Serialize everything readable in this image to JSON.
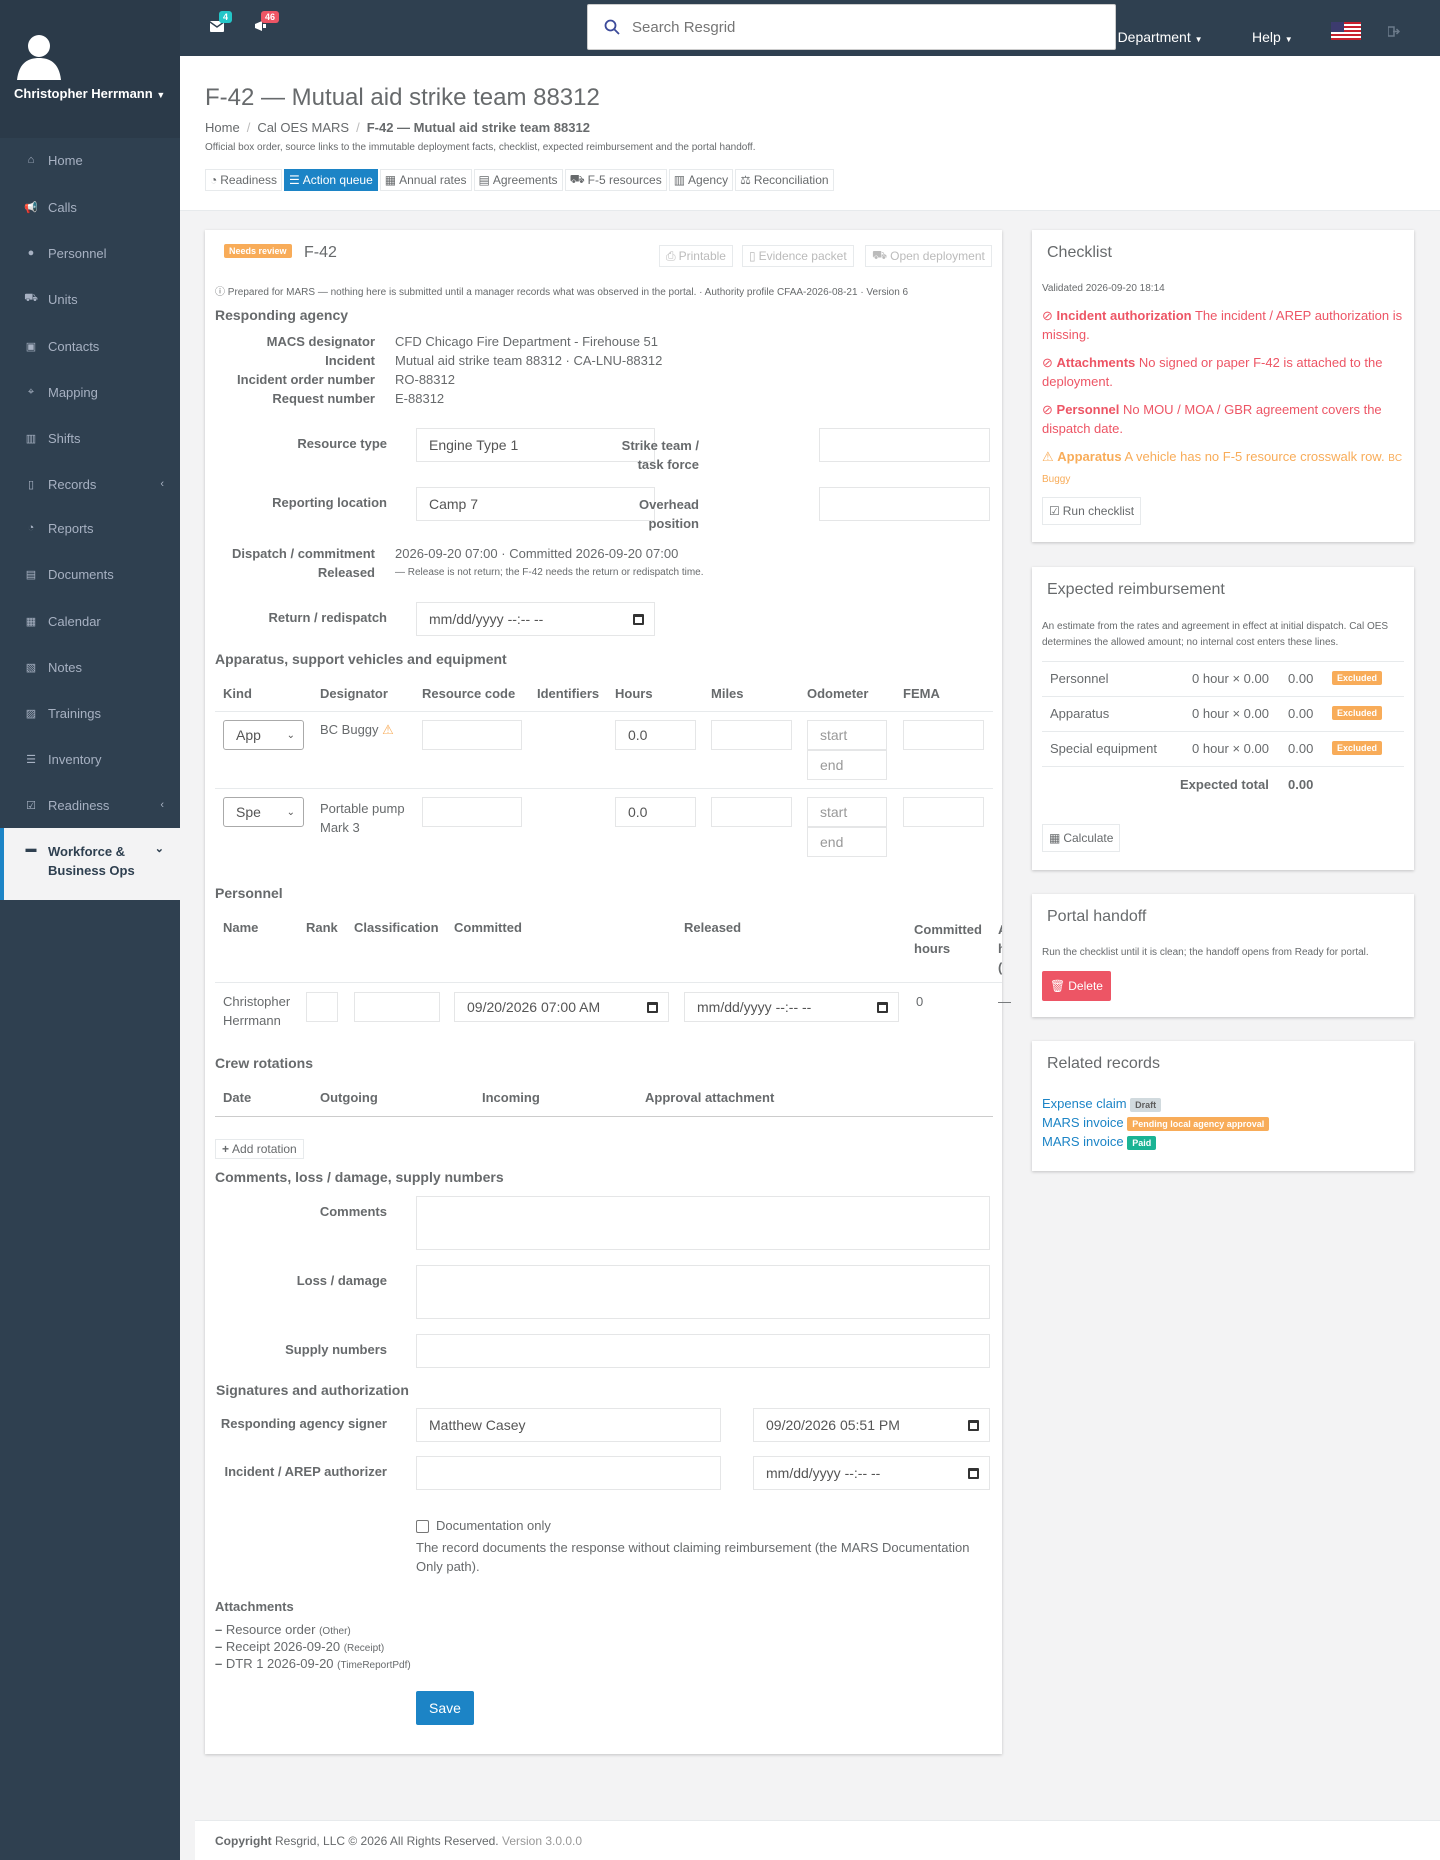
{
  "user": {
    "name": "Christopher Herrmann"
  },
  "nav": [
    {
      "label": "Home",
      "icon": "home-icon"
    },
    {
      "label": "Calls",
      "icon": "bullhorn-icon"
    },
    {
      "label": "Personnel",
      "icon": "user-icon"
    },
    {
      "label": "Units",
      "icon": "truck-icon"
    },
    {
      "label": "Contacts",
      "icon": "address-book-icon"
    },
    {
      "label": "Mapping",
      "icon": "map-marker-icon"
    },
    {
      "label": "Shifts",
      "icon": "building-icon"
    },
    {
      "label": "Records",
      "icon": "file-icon"
    },
    {
      "label": "Reports",
      "icon": "chart-icon"
    },
    {
      "label": "Documents",
      "icon": "document-icon"
    },
    {
      "label": "Calendar",
      "icon": "calendar-icon"
    },
    {
      "label": "Notes",
      "icon": "notes-icon"
    },
    {
      "label": "Trainings",
      "icon": "book-icon"
    },
    {
      "label": "Inventory",
      "icon": "list-icon"
    },
    {
      "label": "Readiness",
      "icon": "check-square-icon"
    },
    {
      "label": "Workforce & Business Ops",
      "icon": "briefcase-icon"
    }
  ],
  "topbar": {
    "mail_count": "4",
    "alerts_count": "46",
    "search_placeholder": "Search Resgrid",
    "department": "Test Department",
    "help": "Help"
  },
  "page": {
    "title": "F-42 — Mutual aid strike team 88312",
    "breadcrumb": [
      "Home",
      "Cal OES MARS",
      "F-42 — Mutual aid strike team 88312"
    ],
    "subtitle": "Official box order, source links to the immutable deployment facts, checklist, expected reimbursement and the portal handoff.",
    "tabs": [
      "Readiness",
      "Action queue",
      "Annual rates",
      "Agreements",
      "F-5 resources",
      "Agency",
      "Reconciliation"
    ]
  },
  "form": {
    "status_badge": "Needs review",
    "heading": "F-42",
    "buttons": {
      "printable": "Printable",
      "evidence": "Evidence packet",
      "open": "Open deployment"
    },
    "notice": "Prepared for MARS — nothing here is submitted until a manager records what was observed in the portal. · Authority profile CFAA-2026-08-21 · Version 6",
    "responding_agency": {
      "heading": "Responding agency",
      "rows": [
        {
          "label": "MACS designator",
          "value": "CFD Chicago Fire Department - Firehouse 51"
        },
        {
          "label": "Incident",
          "value": "Mutual aid strike team 88312 · CA-LNU-88312"
        },
        {
          "label": "Incident order number",
          "value": "RO-88312"
        },
        {
          "label": "Request number",
          "value": "E-88312"
        }
      ]
    },
    "resource_type_label": "Resource type",
    "resource_type_value": "Engine Type 1",
    "strike_team_label": "Strike team / task force",
    "reporting_location_label": "Reporting location",
    "reporting_location_value": "Camp 7",
    "overhead_label": "Overhead position",
    "dispatch_label": "Dispatch / commitment",
    "dispatch_value": "2026-09-20 07:00 · Committed 2026-09-20 07:00",
    "released_label": "Released",
    "released_note": "— Release is not return; the F-42 needs the return or redispatch time.",
    "return_label": "Return / redispatch",
    "datetime_placeholder": "mm/dd/yyyy --:-- --",
    "apparatus": {
      "heading": "Apparatus, support vehicles and equipment",
      "columns": [
        "Kind",
        "Designator",
        "Resource code",
        "Identifiers",
        "Hours",
        "Miles",
        "Odometer",
        "FEMA"
      ],
      "rows": [
        {
          "kind": "App",
          "designator": "BC Buggy",
          "hours": "0.0",
          "start": "start",
          "end": "end"
        },
        {
          "kind": "Spe",
          "designator": "Portable pump Mark 3",
          "hours": "0.0",
          "start": "start",
          "end": "end"
        }
      ]
    },
    "personnel": {
      "heading": "Personnel",
      "columns": [
        "Name",
        "Rank",
        "Classification",
        "Committed",
        "Released",
        "Committed hours",
        "Actual hours (DTRs"
      ],
      "row": {
        "name": "Christopher Herrmann",
        "committed": "09/20/2026 07:00 AM",
        "released": "mm/dd/yyyy --:-- --",
        "committed_hours": "0",
        "actual": "—"
      }
    },
    "crew": {
      "heading": "Crew rotations",
      "columns": [
        "Date",
        "Outgoing",
        "Incoming",
        "Approval attachment"
      ],
      "add_button": "Add rotation"
    },
    "comments": {
      "heading": "Comments, loss / damage, supply numbers",
      "comments_label": "Comments",
      "loss_label": "Loss / damage",
      "supply_label": "Supply numbers"
    },
    "signatures": {
      "heading": "Signatures and authorization",
      "signer_label": "Responding agency signer",
      "signer_value": "Matthew Casey",
      "signer_date": "09/20/2026 05:51 PM",
      "arep_label": "Incident / AREP authorizer",
      "arep_date": "mm/dd/yyyy --:-- --",
      "doc_only_label": "Documentation only",
      "doc_only_note": "The record documents the response without claiming reimbursement (the MARS Documentation Only path)."
    },
    "attachments": {
      "heading": "Attachments",
      "items": [
        {
          "name": "Resource order",
          "type": "(Other)"
        },
        {
          "name": "Receipt 2026-09-20",
          "type": "(Receipt)"
        },
        {
          "name": "DTR 1 2026-09-20",
          "type": "(TimeReportPdf)"
        }
      ]
    },
    "save": "Save"
  },
  "checklist": {
    "title": "Checklist",
    "validated": "Validated 2026-09-20 18:14",
    "items": [
      {
        "title": "Incident authorization",
        "text": "The incident / AREP authorization is missing.",
        "level": "error"
      },
      {
        "title": "Attachments",
        "text": "No signed or paper F-42 is attached to the deployment.",
        "level": "error"
      },
      {
        "title": "Personnel",
        "text": "No MOU / MOA / GBR agreement covers the dispatch date.",
        "level": "error"
      },
      {
        "title": "Apparatus",
        "text": "A vehicle has no F-5 resource crosswalk row.",
        "extra": "BC Buggy",
        "level": "warning"
      }
    ],
    "button": "Run checklist"
  },
  "reimbursement": {
    "title": "Expected reimbursement",
    "note": "An estimate from the rates and agreement in effect at initial dispatch. Cal OES determines the allowed amount; no internal cost enters these lines.",
    "rows": [
      {
        "label": "Personnel",
        "calc": "0 hour × 0.00",
        "amount": "0.00",
        "badge": "Excluded"
      },
      {
        "label": "Apparatus",
        "calc": "0 hour × 0.00",
        "amount": "0.00",
        "badge": "Excluded"
      },
      {
        "label": "Special equipment",
        "calc": "0 hour × 0.00",
        "amount": "0.00",
        "badge": "Excluded"
      }
    ],
    "total_label": "Expected total",
    "total": "0.00",
    "button": "Calculate"
  },
  "portal": {
    "title": "Portal handoff",
    "note": "Run the checklist until it is clean; the handoff opens from Ready for portal.",
    "delete": "Delete"
  },
  "related": {
    "title": "Related records",
    "items": [
      {
        "label": "Expense claim",
        "badge": "Draft",
        "color": "#d1dade"
      },
      {
        "label": "MARS invoice",
        "badge": "Pending local agency approval",
        "color": "#f8ac59"
      },
      {
        "label": "MARS invoice",
        "badge": "Paid",
        "color": "#1ab394"
      }
    ]
  },
  "footer": {
    "copyright": "Copyright",
    "company": "Resgrid, LLC © 2026 All Rights Reserved.",
    "version": "Version 3.0.0.0"
  },
  "colors": {
    "sidebar": "#2f4050",
    "accent": "#1c84c6",
    "danger": "#ed5565",
    "warning": "#f8ac59",
    "success": "#1ab394"
  }
}
